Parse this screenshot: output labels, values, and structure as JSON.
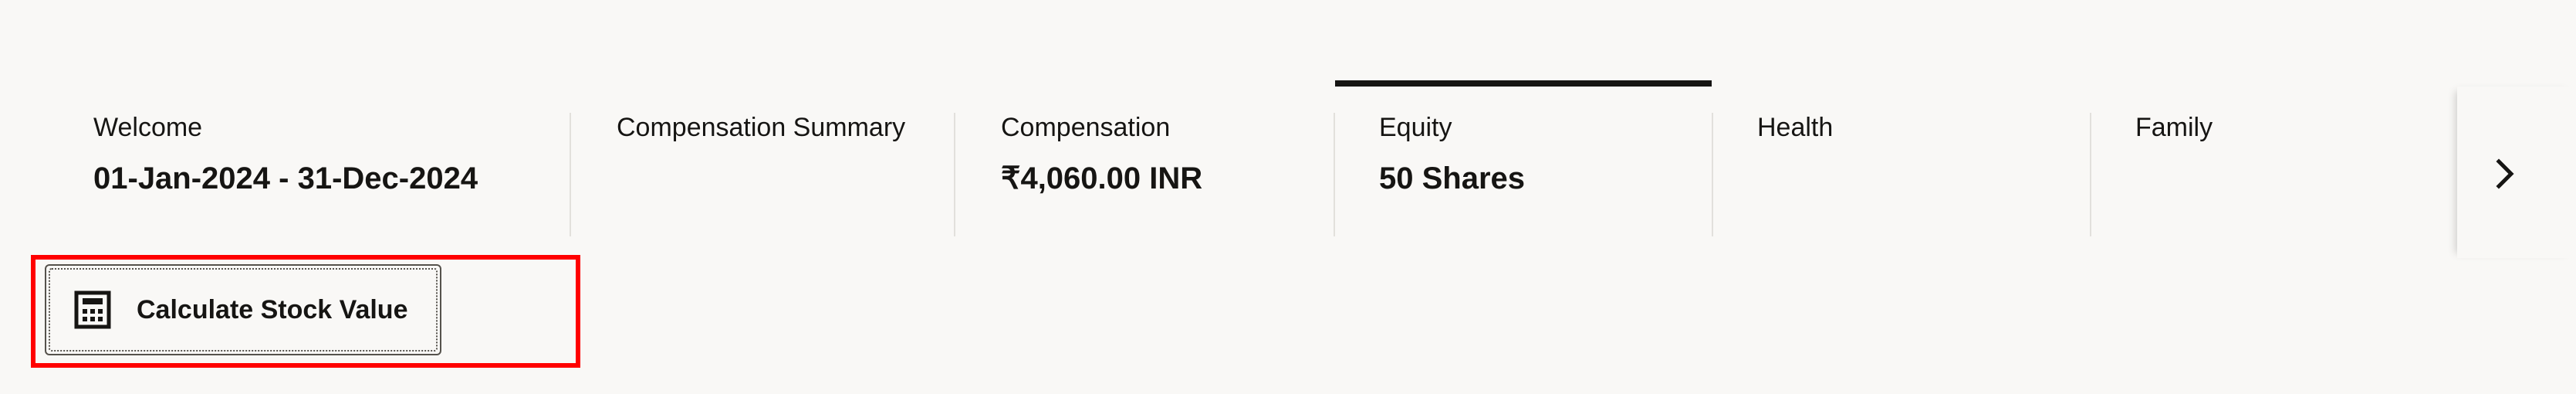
{
  "tabs": [
    {
      "title": "Welcome",
      "value": "01-Jan-2024 - 31-Dec-2024",
      "selected": false
    },
    {
      "title": "Compensation Summary",
      "value": "",
      "selected": false
    },
    {
      "title": "Compensation",
      "value": "₹4,060.00 INR",
      "selected": false
    },
    {
      "title": "Equity",
      "value": "50 Shares",
      "selected": true
    },
    {
      "title": "Health",
      "value": "",
      "selected": false
    },
    {
      "title": "Family",
      "value": "",
      "selected": false
    }
  ],
  "scroll_next_icon": "chevron-right-icon",
  "action": {
    "icon": "calculator-icon",
    "label": "Calculate Stock Value"
  },
  "colors": {
    "background": "#f9f8f6",
    "text": "#161513",
    "selected_indicator": "#161513",
    "highlight_border": "#ff0000",
    "divider": "#e2e0dc"
  }
}
